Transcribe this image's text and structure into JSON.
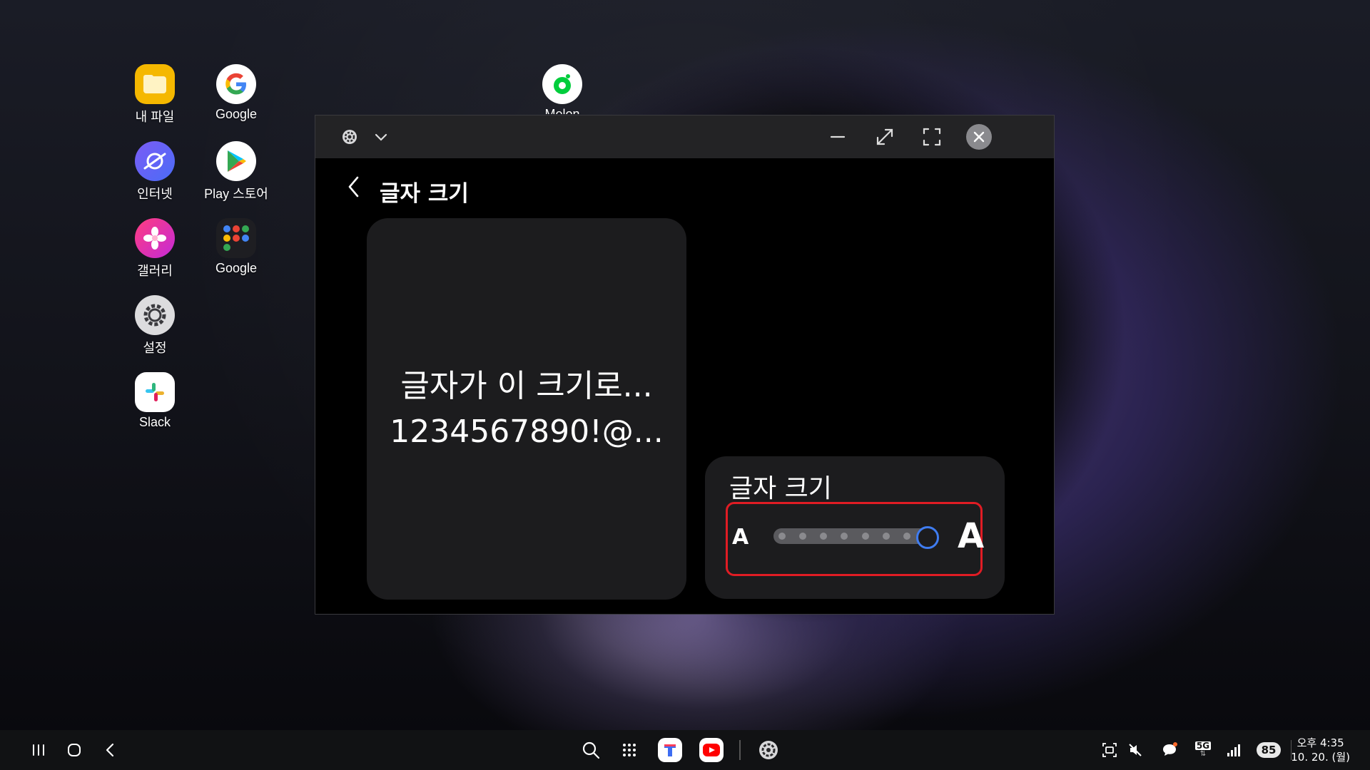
{
  "desktop": {
    "icons": [
      {
        "label": "내 파일"
      },
      {
        "label": "Google"
      },
      {
        "label": "인터넷"
      },
      {
        "label": "Play 스토어"
      },
      {
        "label": "갤러리"
      },
      {
        "label": "Google"
      },
      {
        "label": "설정"
      },
      {
        "label": "Slack"
      },
      {
        "label": "Melon"
      }
    ]
  },
  "window": {
    "page_title": "글자 크기",
    "preview": {
      "line1": "글자가 이 크기로...",
      "line2": "1234567890!@..."
    },
    "font_size_control": {
      "title": "글자 크기",
      "small_label": "A",
      "large_label": "A",
      "steps": 8,
      "current_step": 8,
      "accent_color": "#3f7cf0",
      "highlight_color": "#e01c24"
    }
  },
  "taskbar": {
    "network": "5G",
    "battery": "85",
    "clock": {
      "time": "오후 4:35",
      "date": "10. 20. (월)"
    }
  }
}
